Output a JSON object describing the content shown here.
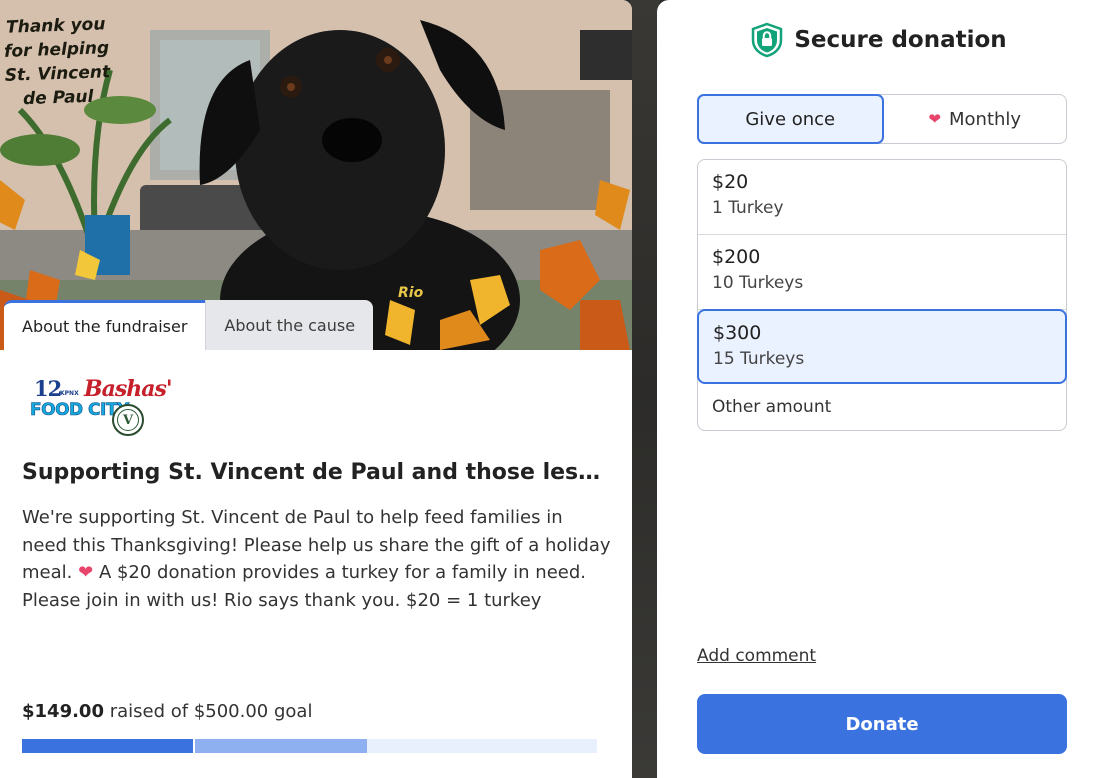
{
  "hero": {
    "caption": "Thank you for helping St. Vincent de Paul",
    "signature": "Rio"
  },
  "tabs": [
    {
      "label": "About the fundraiser"
    },
    {
      "label": "About the cause"
    }
  ],
  "logos": {
    "channel": "12",
    "channel_sub": "KPNX",
    "store": "Bashas'",
    "food_city": "FOOD CITY",
    "seal": "V"
  },
  "fundraiser": {
    "title": "Supporting St. Vincent de Paul and those less f...",
    "description_part1": "We're supporting St. Vincent de Paul to help feed families in need this Thanksgiving! Please help us share the gift of a holiday meal.",
    "description_part2": "A $20 donation provides a turkey for a family in need. Please join in with us! Rio says thank you. $20 = 1 turkey"
  },
  "progress": {
    "raised": "$149.00",
    "goal_text": "raised of $500.00 goal",
    "raised_fraction": 0.298,
    "pending_fraction": 0.6
  },
  "donation": {
    "title": "Secure donation",
    "frequency": [
      {
        "label": "Give once",
        "selected": true
      },
      {
        "label": "Monthly",
        "selected": false
      }
    ],
    "amounts": [
      {
        "value": "$20",
        "desc": "1 Turkey",
        "selected": false
      },
      {
        "value": "$200",
        "desc": "10 Turkeys",
        "selected": false
      },
      {
        "value": "$300",
        "desc": "15 Turkeys",
        "selected": true
      }
    ],
    "other_label": "Other amount",
    "comment_label": "Add comment",
    "donate_label": "Donate"
  },
  "colors": {
    "accent": "#3a73e0",
    "accent_light": "#eaf1ff",
    "heart": "#e8456d",
    "shield": "#12a37a"
  }
}
